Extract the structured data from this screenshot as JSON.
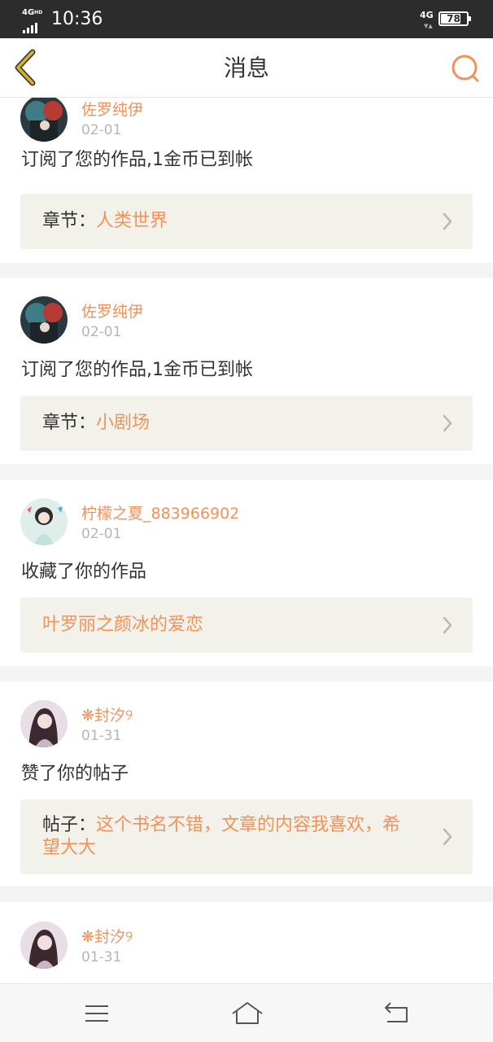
{
  "status": {
    "network_left": "4G",
    "network_left_sup": "HD",
    "time": "10:36",
    "network_right": "4G",
    "battery": "78"
  },
  "header": {
    "title": "消息"
  },
  "messages": [
    {
      "user": "佐罗纯伊",
      "date": "02-01",
      "action": "订阅了您的作品,1金币已到帐",
      "ref_label": "章节：",
      "ref_value": "人类世界"
    },
    {
      "user": "佐罗纯伊",
      "date": "02-01",
      "action": "订阅了您的作品,1金币已到帐",
      "ref_label": "章节：",
      "ref_value": "小剧场"
    },
    {
      "user": "柠檬之夏_883966902",
      "date": "02-01",
      "action": "收藏了你的作品",
      "ref_label": "",
      "ref_value": "叶罗丽之颜冰的爱恋"
    },
    {
      "user": "❋封汐୨",
      "date": "01-31",
      "action": "赞了你的帖子",
      "ref_label": "帖子：",
      "ref_value_line1": "这个书名不错，文章的内容我喜欢，希",
      "ref_value_line2": "望大大"
    },
    {
      "user": "❋封汐୨",
      "date": "01-31"
    }
  ],
  "colors": {
    "accent": "#f0925a",
    "back_icon": "#d9b12a",
    "ref_bg": "#f3f2ea",
    "status_bg": "#2c2c2c"
  },
  "icons": {
    "back": "chevron-left-icon",
    "search": "search-icon",
    "chevron": "chevron-right-icon",
    "menu": "menu-icon",
    "home": "home-icon",
    "return": "return-icon"
  }
}
